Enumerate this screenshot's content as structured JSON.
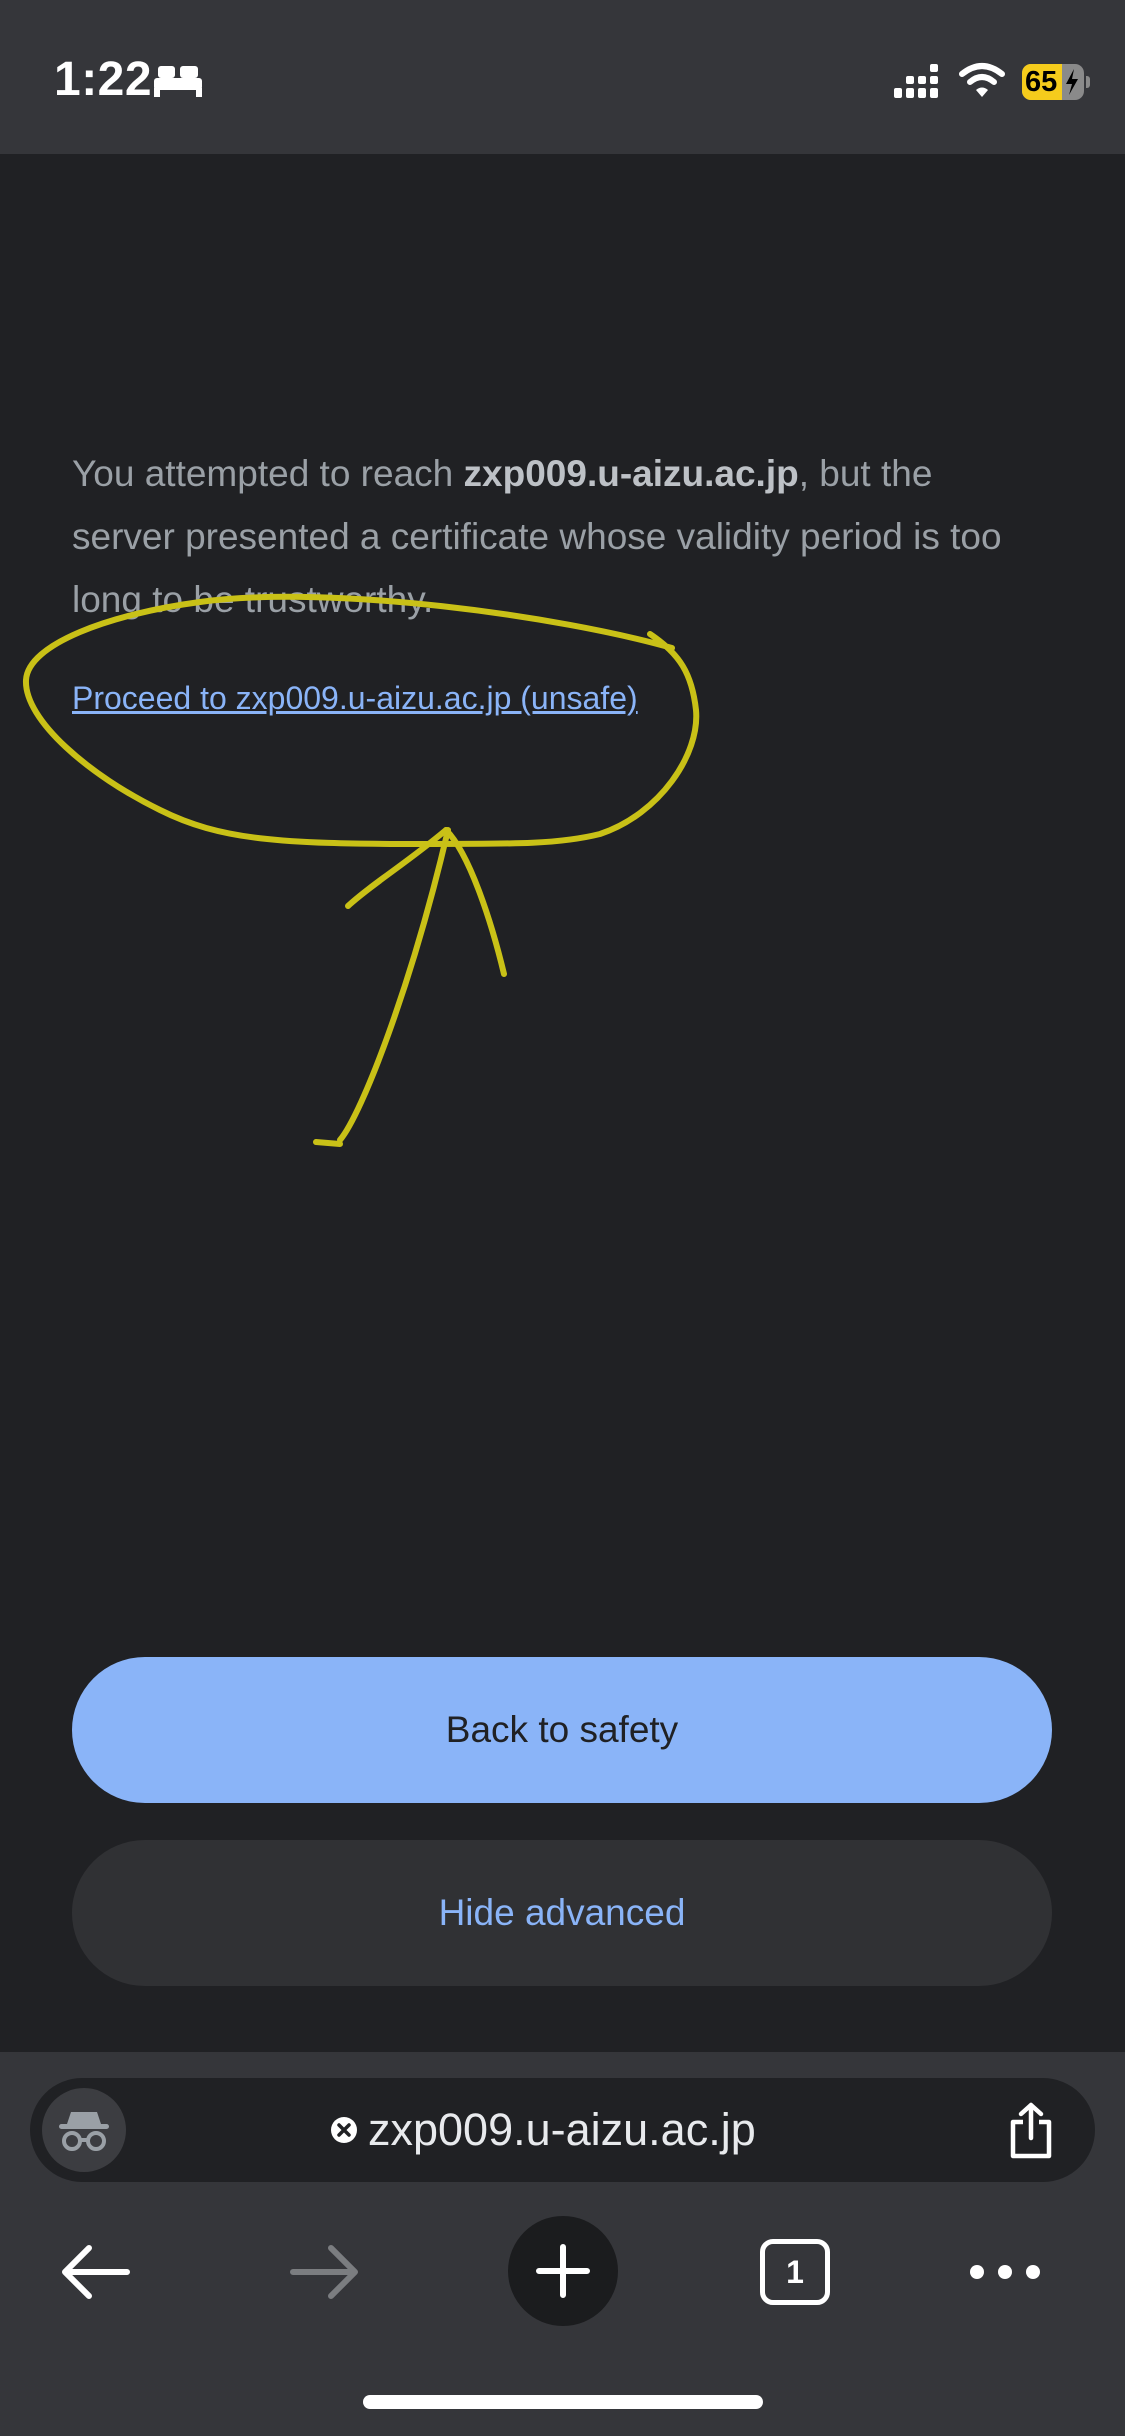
{
  "status_bar": {
    "time": "1:22",
    "battery_percent": "65",
    "battery_level": 0.65,
    "icons": [
      "bed-icon",
      "cellular-signal-icon",
      "wifi-icon",
      "battery-charging-icon"
    ]
  },
  "interstitial": {
    "text_before": "You attempted to reach ",
    "domain": "zxp009.u-aizu.ac.jp",
    "text_after": ", but the server presented a certificate whose validity period is too long to be trustworthy.",
    "proceed_link": "Proceed to zxp009.u-aizu.ac.jp (unsafe)",
    "back_button": "Back to safety",
    "hide_advanced_button": "Hide advanced"
  },
  "annotation": {
    "color": "#c9c117",
    "shapes": [
      "circle",
      "arrow"
    ]
  },
  "toolbar": {
    "url": "zxp009.u-aizu.ac.jp",
    "tab_count": "1",
    "icons": [
      "incognito-icon",
      "not-secure-icon",
      "share-icon",
      "back-arrow-icon",
      "forward-arrow-icon",
      "plus-icon",
      "tab-switcher-icon",
      "more-icon"
    ]
  },
  "colors": {
    "background": "#202124",
    "toolbar": "#35363a",
    "accent_blue": "#8ab4f8",
    "body_text": "#9aa0a6"
  }
}
